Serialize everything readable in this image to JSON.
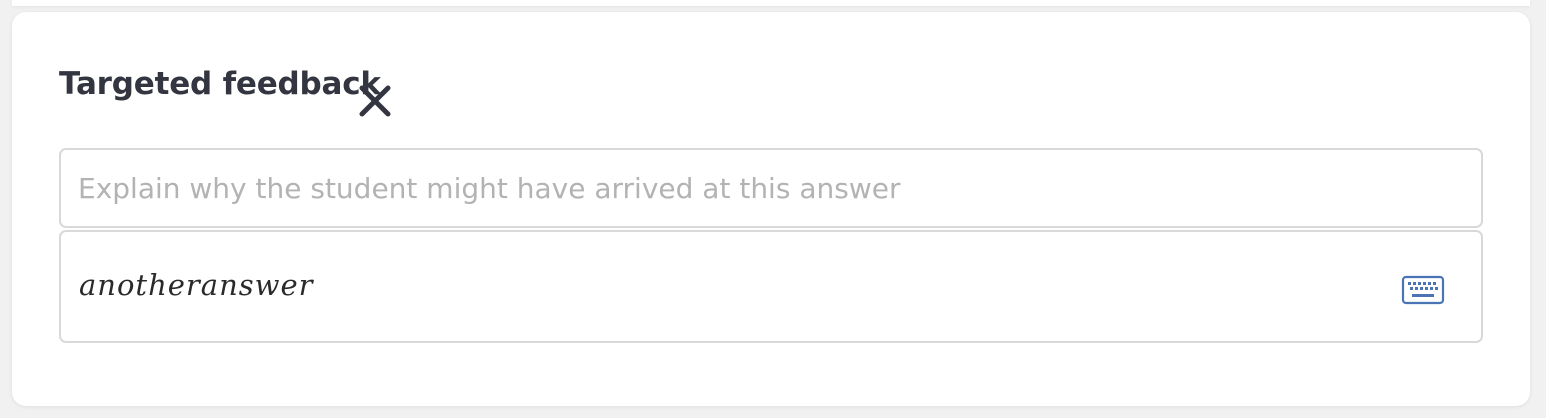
{
  "feedback_panel": {
    "title": "Targeted feedback",
    "close_icon": "close-icon",
    "feedback_input": {
      "value": "",
      "placeholder": "Explain why the student might have arrived at this answer"
    },
    "answer": {
      "value": "anotheranswer",
      "keyboard_icon": "keyboard-icon"
    },
    "colors": {
      "accent": "#4a74b4",
      "title": "#333640",
      "border": "#d9d9d9"
    }
  }
}
